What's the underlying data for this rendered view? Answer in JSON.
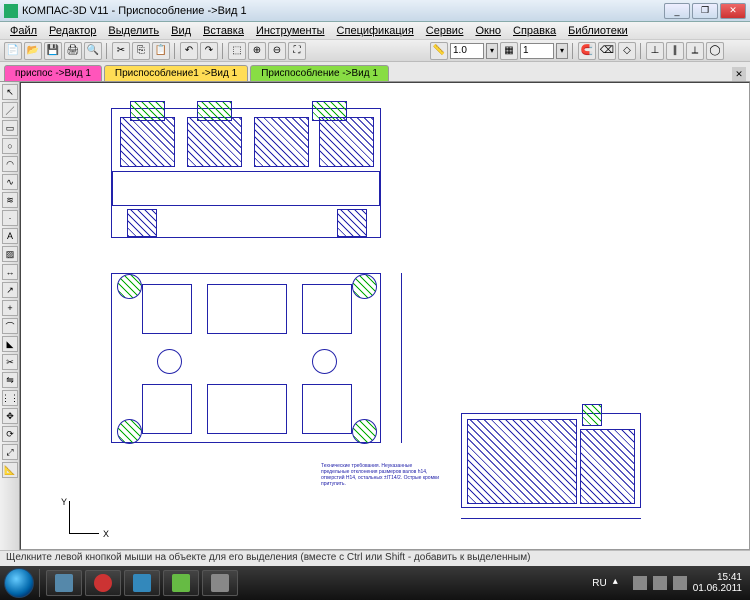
{
  "title": "КОМПАС-3D V11 - Приспособление ->Вид 1",
  "menu": [
    "Файл",
    "Редактор",
    "Выделить",
    "Вид",
    "Вставка",
    "Инструменты",
    "Спецификация",
    "Сервис",
    "Окно",
    "Справка",
    "Библиотеки"
  ],
  "toolbar": {
    "scale": "1.0",
    "zoom": "1"
  },
  "tabs": {
    "t1": "приспос ->Вид 1",
    "t2": "Приспособление1 ->Вид 1",
    "t3": "Приспособление ->Вид 1"
  },
  "axis": {
    "x": "X",
    "y": "Y"
  },
  "status": "Щелкните левой кнопкой мыши на объекте для его выделения (вместе с Ctrl или Shift - добавить к выделенным)",
  "tray": {
    "lang": "RU",
    "time": "15:41",
    "date": "01.06.2011"
  }
}
